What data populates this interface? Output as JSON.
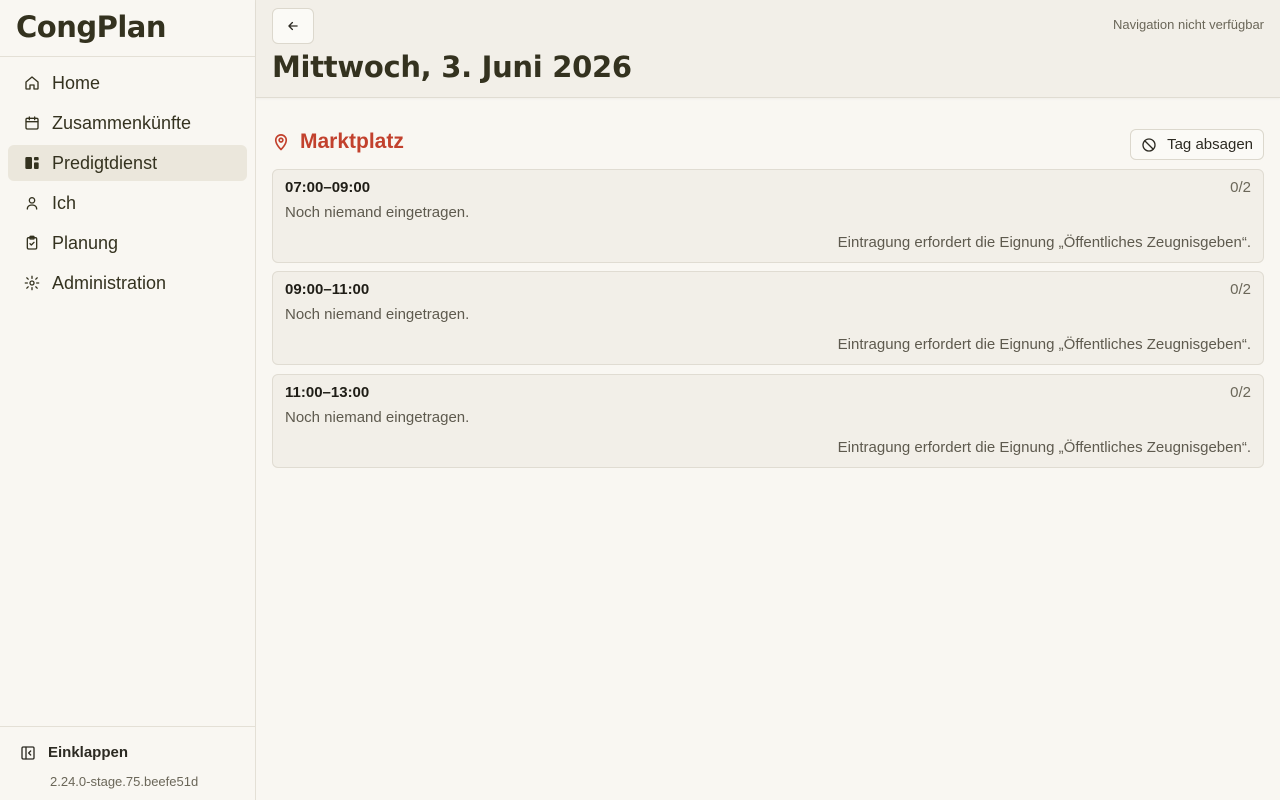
{
  "app": {
    "title": "CongPlan"
  },
  "sidebar": {
    "items": [
      {
        "label": "Home",
        "icon": "home-icon",
        "active": false
      },
      {
        "label": "Zusammenkünfte",
        "icon": "calendar-icon",
        "active": false
      },
      {
        "label": "Predigtdienst",
        "icon": "cart-icon",
        "active": true
      },
      {
        "label": "Ich",
        "icon": "user-icon",
        "active": false
      },
      {
        "label": "Planung",
        "icon": "clipboard-check-icon",
        "active": false
      },
      {
        "label": "Administration",
        "icon": "gear-icon",
        "active": false
      }
    ],
    "collapse_label": "Einklappen",
    "version": "2.24.0-stage.75.beefe51d"
  },
  "header": {
    "nav_status": "Navigation nicht verfügbar",
    "title": "Mittwoch, 3. Juni 2026"
  },
  "location": {
    "name": "Marktplatz",
    "cancel_label": "Tag absagen",
    "accent_color": "#c2412d"
  },
  "slots": [
    {
      "time": "07:00–09:00",
      "count": "0/2",
      "status": "Noch niemand eingetragen.",
      "requirement": "Eintragung erfordert die Eignung „Öffentliches Zeugnisgeben“."
    },
    {
      "time": "09:00–11:00",
      "count": "0/2",
      "status": "Noch niemand eingetragen.",
      "requirement": "Eintragung erfordert die Eignung „Öffentliches Zeugnisgeben“."
    },
    {
      "time": "11:00–13:00",
      "count": "0/2",
      "status": "Noch niemand eingetragen.",
      "requirement": "Eintragung erfordert die Eignung „Öffentliches Zeugnisgeben“."
    }
  ]
}
